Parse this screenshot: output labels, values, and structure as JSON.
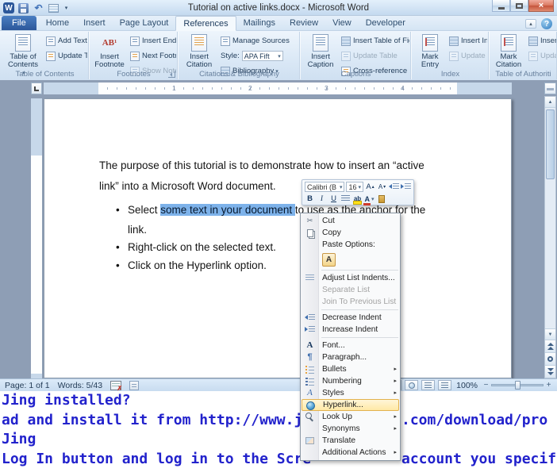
{
  "colors": {
    "file_tab_blue": "#2b579a",
    "selection_blue": "#7db2ea",
    "menu_highlight_orange": "#e3b24e",
    "background_link_blue": "#2222cc",
    "close_button_red": "#c4523a"
  },
  "icons": {
    "w_logo": "W",
    "undo": "↶",
    "dropdown": "▾",
    "submenu": "▸",
    "close": "×",
    "help": "?",
    "collapse_ribbon": "▴",
    "cut": "✂",
    "font_a": "A",
    "styles_a": "A",
    "paragraph_mark": "¶",
    "grow_a": "A",
    "shrink_a": "A",
    "up_small": "▴",
    "down_small": "▾",
    "bold": "B",
    "italic": "I",
    "underline": "U",
    "highlight_ab": "ab",
    "font_color_a": "A",
    "bullet": "•",
    "scroll_up": "▲",
    "scroll_down": "▼",
    "zoom_out": "−",
    "zoom_in": "+",
    "spell_x": "✗"
  },
  "titlebar": {
    "title": "Tutorial on active links.docx - Microsoft Word"
  },
  "tabs": {
    "file": "File",
    "home": "Home",
    "insert": "Insert",
    "page_layout": "Page Layout",
    "references": "References",
    "mailings": "Mailings",
    "review": "Review",
    "view": "View",
    "developer": "Developer"
  },
  "ribbon": {
    "toc": {
      "big": "Table of Contents",
      "add_text": "Add Text",
      "update_table": "Update Table",
      "label": "Table of Contents"
    },
    "footnotes": {
      "icon_text": "AB¹",
      "big": "Insert Footnote",
      "insert_endnote": "Insert Endnote",
      "next_footnote": "Next Footnote",
      "show_notes": "Show Notes",
      "label": "Footnotes"
    },
    "citations": {
      "big": "Insert Citation",
      "manage_sources": "Manage Sources",
      "style_label": "Style:",
      "style_value": "APA Fift",
      "bibliography": "Bibliography",
      "label": "Citations & Bibliography"
    },
    "captions": {
      "big": "Insert Caption",
      "insert_tof": "Insert Table of Figures",
      "update_table": "Update Table",
      "cross_reference": "Cross-reference",
      "label": "Captions"
    },
    "index": {
      "big": "Mark Entry",
      "insert_index": "Insert Index",
      "update_index": "Update Index",
      "label": "Index"
    },
    "authorities": {
      "big": "Mark Citation",
      "insert_toa": "Insert Table of",
      "update_table": "Update Table",
      "label": "Table of Authoriti"
    }
  },
  "ruler": {
    "numbers": [
      "1",
      "2",
      "3",
      "4"
    ]
  },
  "document": {
    "paragraph_line1": "The purpose of this tutorial is to demonstrate how to insert an “active",
    "paragraph_line2": "link” into a Microsoft Word document.",
    "bullet1_pre": "Select ",
    "bullet1_selected": "some text in your document ",
    "bullet1_post": "to use as the anchor for the",
    "bullet1_cont": "link.",
    "bullet2": "Right-click on the selected text.",
    "bullet3": "Click on the Hyperlink option."
  },
  "mini_toolbar": {
    "font_name": "Calibri (B",
    "font_size": "16"
  },
  "context_menu": {
    "cut": "Cut",
    "copy": "Copy",
    "paste_options": "Paste Options:",
    "paste_keep_text": "A",
    "adjust_list_indents": "Adjust List Indents...",
    "separate_list": "Separate List",
    "join_previous": "Join To Previous List",
    "decrease_indent": "Decrease Indent",
    "increase_indent": "Increase Indent",
    "font": "Font...",
    "paragraph": "Paragraph...",
    "bullets": "Bullets",
    "numbering": "Numbering",
    "styles": "Styles",
    "hyperlink": "Hyperlink...",
    "look_up": "Look Up",
    "synonyms": "Synonyms",
    "translate": "Translate",
    "additional_actions": "Additional Actions"
  },
  "status_bar": {
    "page": "Page: 1 of 1",
    "words": "Words: 5/43",
    "zoom": "100%"
  },
  "background_text": {
    "line1": "Jing installed?",
    "line2_left": "ad and install it from http://www.ji",
    "line2_right": ".com/download/pro",
    "line3": "Jing",
    "line4_left": "Log In button and log in to the Scre",
    "line4_right": "account you specifi"
  }
}
